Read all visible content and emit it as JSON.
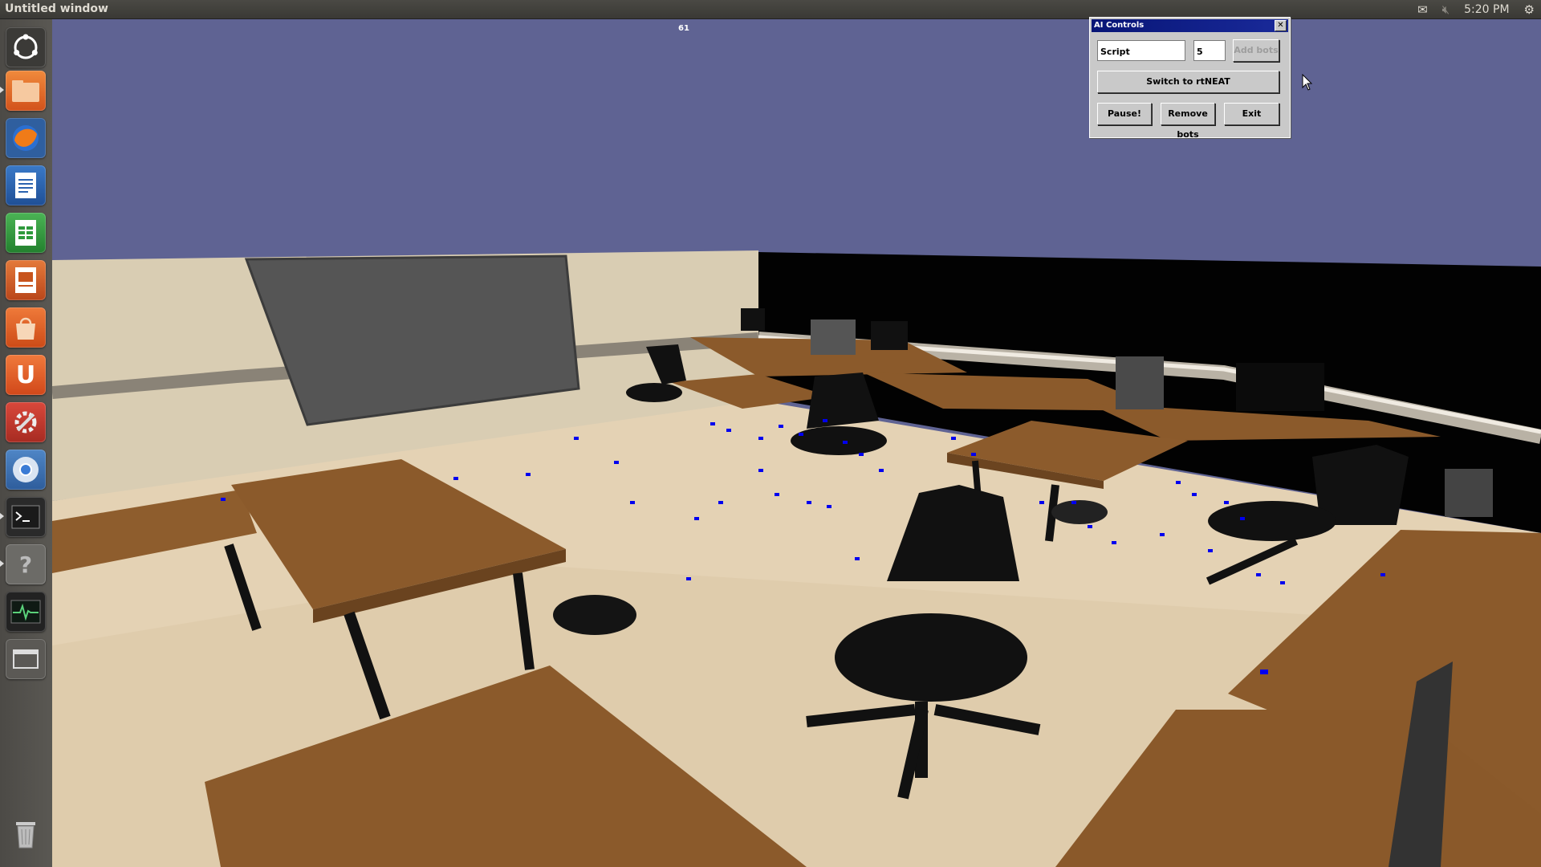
{
  "window": {
    "title": "Untitled window"
  },
  "tray": {
    "mail_icon": "mail-icon",
    "volume_icon": "volume-muted-icon",
    "clock": "5:20 PM",
    "settings_icon": "gear-icon"
  },
  "launcher": {
    "items": [
      {
        "name": "dash-home",
        "icon": "ubuntu-logo-icon",
        "color": "#3a3a3a"
      },
      {
        "name": "files",
        "icon": "folder-icon",
        "color": "#e76a2b"
      },
      {
        "name": "firefox",
        "icon": "firefox-icon",
        "color": "#2a5d9c"
      },
      {
        "name": "libreoffice-writer",
        "icon": "document-icon",
        "color": "#2b63b0"
      },
      {
        "name": "libreoffice-calc",
        "icon": "spreadsheet-icon",
        "color": "#2e9a3c"
      },
      {
        "name": "libreoffice-impress",
        "icon": "presentation-icon",
        "color": "#c8541d"
      },
      {
        "name": "software-center",
        "icon": "shopping-bag-icon",
        "color": "#df5a20"
      },
      {
        "name": "ubuntu-one",
        "icon": "ubuntu-one-icon",
        "color": "#e05d1f"
      },
      {
        "name": "system-settings",
        "icon": "wrench-icon",
        "color": "#c0392b"
      },
      {
        "name": "chromium",
        "icon": "chromium-icon",
        "color": "#3f74b8"
      },
      {
        "name": "terminal",
        "icon": "terminal-icon",
        "color": "#2c2c2c"
      },
      {
        "name": "help",
        "icon": "help-icon",
        "color": "#6a6966"
      },
      {
        "name": "system-monitor",
        "icon": "system-monitor-icon",
        "color": "#222"
      },
      {
        "name": "workspace-switcher",
        "icon": "workspace-icon",
        "color": "#5d5b57"
      },
      {
        "name": "trash",
        "icon": "trash-icon",
        "color": "#5d5b57"
      }
    ]
  },
  "viewport": {
    "fps": "61"
  },
  "ai_controls": {
    "title": "AI Controls",
    "close_label": "x",
    "mode_value": "Script",
    "count_value": "5",
    "add_bots_label": "Add bots",
    "switch_label": "Switch to rtNEAT",
    "pause_label": "Pause!",
    "remove_label": "Remove bots",
    "exit_label": "Exit"
  }
}
